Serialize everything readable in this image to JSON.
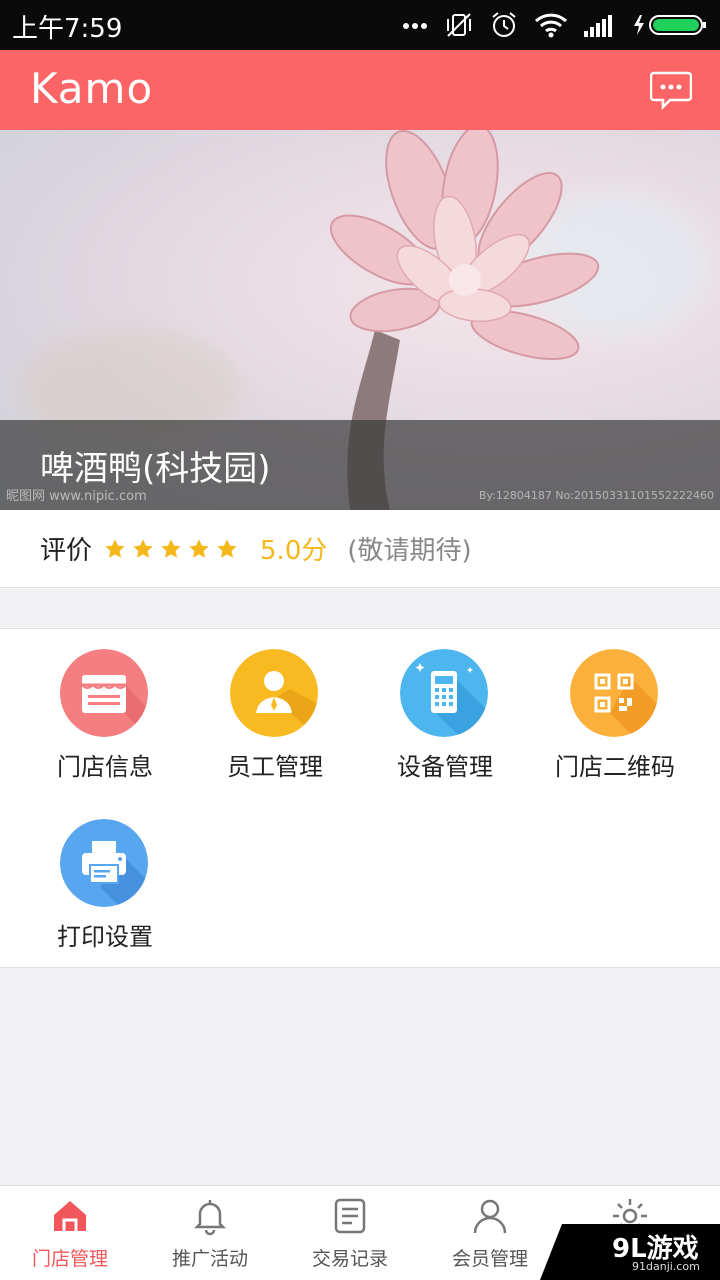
{
  "status_bar": {
    "time": "上午7:59"
  },
  "header": {
    "logo": "Kamo",
    "message_icon": "message-bubble-icon"
  },
  "banner": {
    "store_name": "啤酒鸭(科技园)",
    "watermark_left": "昵图网 www.nipic.com",
    "watermark_right": "By:12804187 No:20150331101552222460"
  },
  "rating": {
    "label": "评价",
    "stars": 5,
    "score": "5.0分",
    "note": "(敬请期待)",
    "star_color": "#f5b81c"
  },
  "menu": {
    "items": [
      {
        "label": "门店信息",
        "icon": "storefront-icon",
        "color": "#f47e80"
      },
      {
        "label": "员工管理",
        "icon": "employee-icon",
        "color": "#f9b921"
      },
      {
        "label": "设备管理",
        "icon": "calculator-icon",
        "color": "#4db6ef"
      },
      {
        "label": "门店二维码",
        "icon": "qrcode-icon",
        "color": "#fbb03b"
      },
      {
        "label": "打印设置",
        "icon": "printer-icon",
        "color": "#58a6f0"
      }
    ]
  },
  "tabbar": {
    "tabs": [
      {
        "label": "门店管理",
        "icon": "home-icon",
        "active": true
      },
      {
        "label": "推广活动",
        "icon": "bell-icon",
        "active": false
      },
      {
        "label": "交易记录",
        "icon": "record-icon",
        "active": false
      },
      {
        "label": "会员管理",
        "icon": "member-icon",
        "active": false
      },
      {
        "label": "",
        "icon": "settings-icon",
        "active": false
      }
    ]
  },
  "watermark": {
    "title": "9L游戏",
    "subtitle": "91danji.com"
  },
  "colors": {
    "accent": "#fb6565",
    "active_tab": "#f0565a"
  }
}
